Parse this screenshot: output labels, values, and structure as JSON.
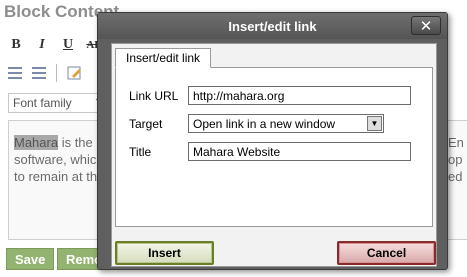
{
  "background": {
    "heading": "Block Content",
    "font_select": "Font family",
    "editor_text": {
      "highlight": "Mahara",
      "line1_rest": " is the",
      "line2": "software, whic",
      "line3": "to remain at th",
      "right_line1": "En",
      "right_line2": "op",
      "right_line3": "ed"
    },
    "buttons": {
      "save": "Save",
      "remove": "Remo"
    }
  },
  "dialog": {
    "title": "Insert/edit link",
    "close_symbol": "✕",
    "tab_label": "Insert/edit link",
    "fields": {
      "url_label": "Link URL",
      "url_value": "http://mahara.org",
      "target_label": "Target",
      "target_value": "Open link in a new window",
      "title_label": "Title",
      "title_value": "Mahara Website"
    },
    "buttons": {
      "insert": "Insert",
      "cancel": "Cancel"
    }
  }
}
